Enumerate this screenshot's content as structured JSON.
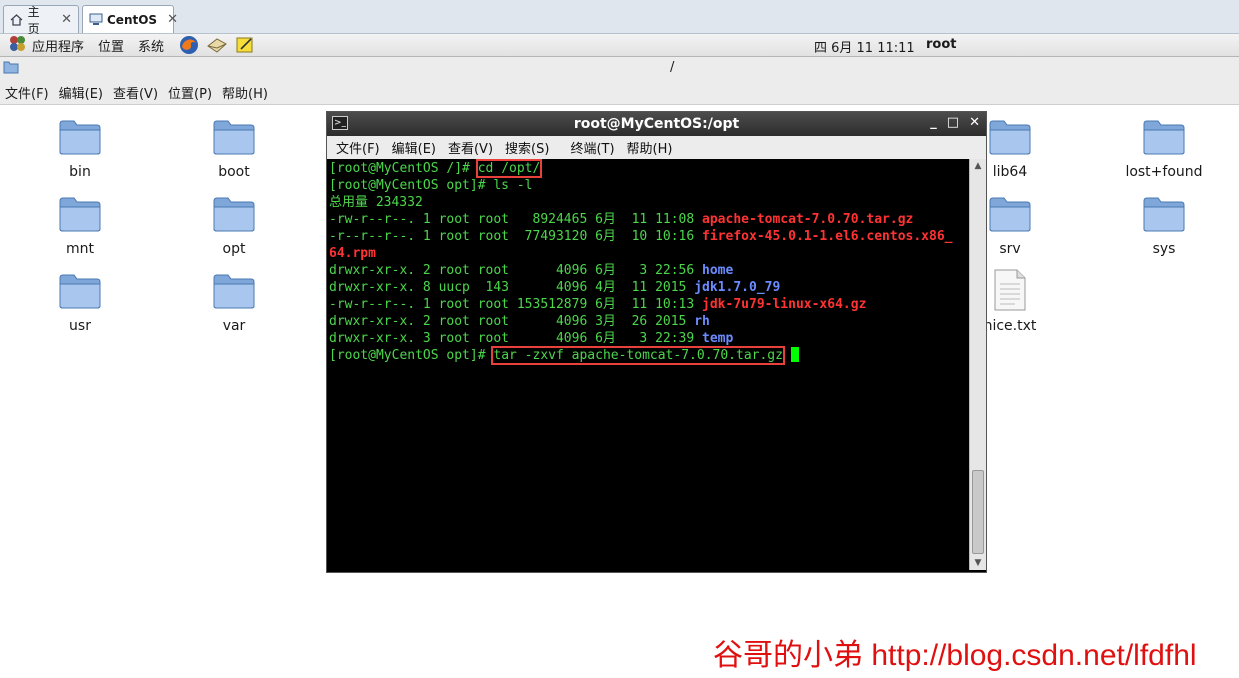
{
  "tabs": [
    {
      "label": "主页",
      "icon": "home-icon",
      "active": false
    },
    {
      "label": "CentOS",
      "icon": "vm-icon",
      "active": true
    }
  ],
  "panel": {
    "applications": "应用程序",
    "places": "位置",
    "system": "系统",
    "clock": "四 6月 11 11:11",
    "user": "root"
  },
  "location": "/",
  "file_menu": [
    "文件(F)",
    "编辑(E)",
    "查看(V)",
    "位置(P)",
    "帮助(H)"
  ],
  "files": [
    {
      "name": "bin",
      "type": "folder"
    },
    {
      "name": "boot",
      "type": "folder"
    },
    {
      "name": "lib64",
      "type": "folder"
    },
    {
      "name": "lost+found",
      "type": "folder"
    },
    {
      "name": "mnt",
      "type": "folder"
    },
    {
      "name": "opt",
      "type": "folder"
    },
    {
      "name": "srv",
      "type": "folder"
    },
    {
      "name": "sys",
      "type": "folder"
    },
    {
      "name": "usr",
      "type": "folder"
    },
    {
      "name": "var",
      "type": "folder"
    },
    {
      "name": "nice.txt",
      "type": "text-file"
    }
  ],
  "terminal": {
    "title": "root@MyCentOS:/opt",
    "menu": [
      "文件(F)",
      "编辑(E)",
      "查看(V)",
      "搜索(S)",
      "终端(T)",
      "帮助(H)"
    ],
    "lines": {
      "l1_prompt": "[root@MyCentOS /]# ",
      "l1_cmd": "cd /opt/",
      "l2": "[root@MyCentOS opt]# ls -l",
      "l3": "总用量 234332",
      "l4_meta": "-rw-r--r--. 1 root root   8924465 6月  11 11:08 ",
      "l4_name": "apache-tomcat-7.0.70.tar.gz",
      "l5_meta": "-r--r--r--. 1 root root  77493120 6月  10 10:16 ",
      "l5_name": "firefox-45.0.1-1.el6.centos.x86_",
      "l6_name": "64.rpm",
      "l7_meta": "drwxr-xr-x. 2 root root      4096 6月   3 22:56 ",
      "l7_name": "home",
      "l8_meta": "drwxr-xr-x. 8 uucp  143      4096 4月  11 2015 ",
      "l8_name": "jdk1.7.0_79",
      "l9_meta": "-rw-r--r--. 1 root root 153512879 6月  11 10:13 ",
      "l9_name": "jdk-7u79-linux-x64.gz",
      "l10_meta": "drwxr-xr-x. 2 root root      4096 3月  26 2015 ",
      "l10_name": "rh",
      "l11_meta": "drwxr-xr-x. 3 root root      4096 6月   3 22:39 ",
      "l11_name": "temp",
      "l12_prompt": "[root@MyCentOS opt]# ",
      "l12_cmd": "tar -zxvf apache-tomcat-7.0.70.tar.gz"
    }
  },
  "watermark": "谷哥的小弟 http://blog.csdn.net/lfdfhl",
  "colors": {
    "terminal_green": "#4cd64c",
    "archive_red": "#ff3333",
    "dir_blue": "#6b8cff",
    "highlight_box": "#e8403a"
  }
}
